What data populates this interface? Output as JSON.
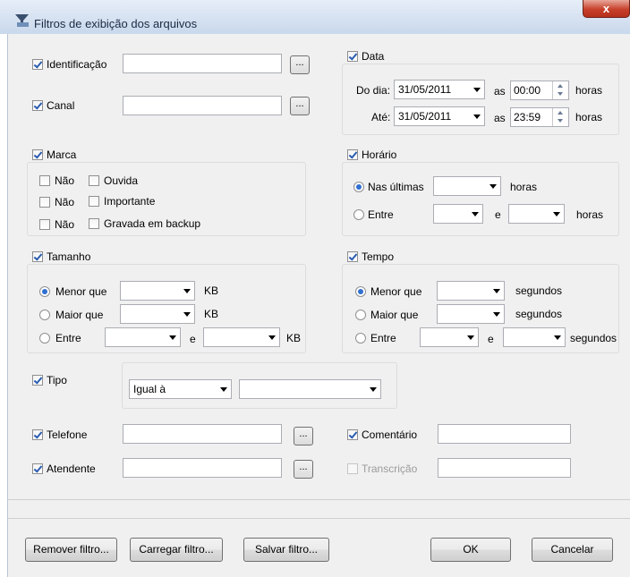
{
  "window": {
    "title": "Filtros de exibição dos arquivos",
    "close": "x"
  },
  "identificacao": {
    "label": "Identificação",
    "value": "",
    "browse": "..."
  },
  "canal": {
    "label": "Canal",
    "value": "",
    "browse": "..."
  },
  "data": {
    "label": "Data",
    "from_label": "Do dia:",
    "from_date": "31/05/2011",
    "as": "as",
    "from_time": "00:00",
    "to_label": "Até:",
    "to_date": "31/05/2011",
    "to_time": "23:59",
    "horas": "horas"
  },
  "marca": {
    "label": "Marca",
    "nao": "Não",
    "ouvida": "Ouvida",
    "importante": "Importante",
    "backup": "Gravada em backup"
  },
  "horario": {
    "label": "Horário",
    "ultimas": "Nas últimas",
    "entre": "Entre",
    "e": "e",
    "horas": "horas"
  },
  "tamanho": {
    "label": "Tamanho",
    "menor": "Menor que",
    "maior": "Maior que",
    "entre": "Entre",
    "e": "e",
    "unit": "KB"
  },
  "tempo": {
    "label": "Tempo",
    "menor": "Menor que",
    "maior": "Maior que",
    "entre": "Entre",
    "e": "e",
    "unit": "segundos"
  },
  "tipo": {
    "label": "Tipo",
    "operator": "Igual à",
    "value": ""
  },
  "telefone": {
    "label": "Telefone",
    "value": "",
    "browse": "..."
  },
  "atendente": {
    "label": "Atendente",
    "value": "",
    "browse": "..."
  },
  "comentario": {
    "label": "Comentário",
    "value": ""
  },
  "transcricao": {
    "label": "Transcrição",
    "value": ""
  },
  "buttons": {
    "remover": "Remover filtro...",
    "carregar": "Carregar filtro...",
    "salvar": "Salvar filtro...",
    "ok": "OK",
    "cancelar": "Cancelar"
  },
  "colors": {
    "accent": "#2f6fd0",
    "close": "#c7402a",
    "dialog_bg": "#f0f0f0"
  }
}
